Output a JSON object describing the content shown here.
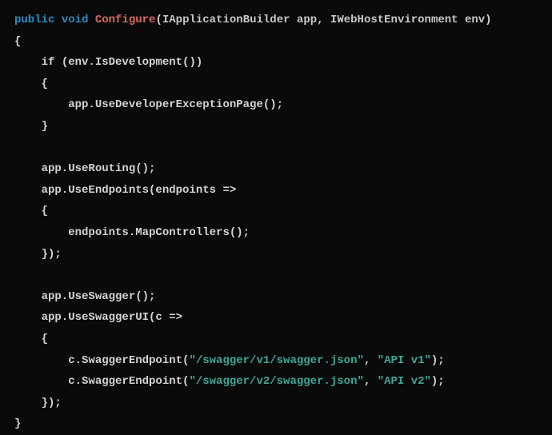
{
  "code": {
    "line1": {
      "public": "public",
      "void": "void",
      "method": "Configure",
      "paren_open": "(",
      "param1_type": "IApplicationBuilder",
      "param1_name": " app,",
      "param2_type": " IWebHostEnvironment",
      "param2_name": " env",
      "paren_close": ")"
    },
    "line2": "{",
    "line3": {
      "if": "if",
      "cond": " (env.IsDevelopment())"
    },
    "line4": "    {",
    "line5": "        app.UseDeveloperExceptionPage();",
    "line6": "    }",
    "line7": "",
    "line8": "    app.UseRouting();",
    "line9": "    app.UseEndpoints(endpoints =>",
    "line10": "    {",
    "line11": "        endpoints.MapControllers();",
    "line12": "    });",
    "line13": "",
    "line14": "    app.UseSwagger();",
    "line15": "    app.UseSwaggerUI(c =>",
    "line16": "    {",
    "line17": {
      "pre": "        c.SwaggerEndpoint(",
      "str1": "\"/swagger/v1/swagger.json\"",
      "mid": ", ",
      "str2": "\"API v1\"",
      "post": ");"
    },
    "line18": {
      "pre": "        c.SwaggerEndpoint(",
      "str1": "\"/swagger/v2/swagger.json\"",
      "mid": ", ",
      "str2": "\"API v2\"",
      "post": ");"
    },
    "line19": "    });",
    "line20": "}"
  }
}
